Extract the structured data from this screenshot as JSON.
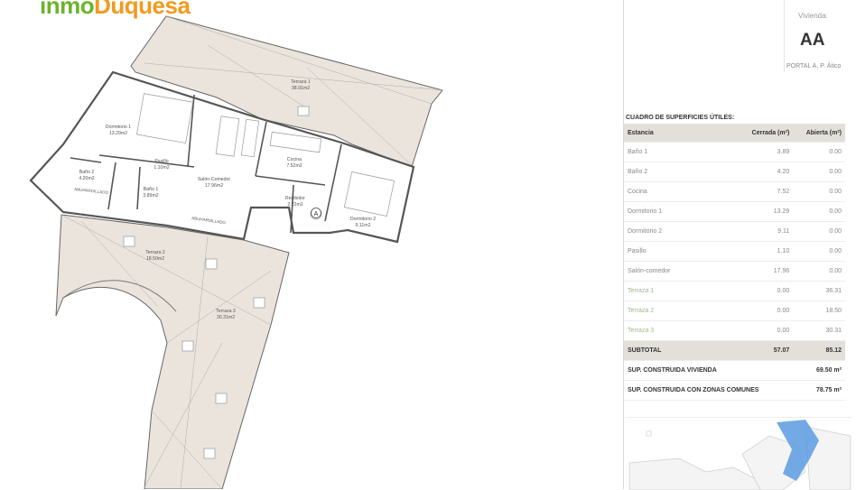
{
  "logo": {
    "part1": "inmo",
    "part2": "Duquesa"
  },
  "plan": {
    "rooms": [
      {
        "id": "terraza1",
        "name": "Terraza 1",
        "area": "38.91m2"
      },
      {
        "id": "dormitorio1",
        "name": "Dormitorio 1",
        "area": "13.29m2"
      },
      {
        "id": "pasillo",
        "name": "Pasillo",
        "area": "1.10m2"
      },
      {
        "id": "bano2",
        "name": "Baño 2",
        "area": "4.20m2"
      },
      {
        "id": "bano1",
        "name": "Baño 1",
        "area": "3.89m2"
      },
      {
        "id": "salon",
        "name": "Salón-Comedor",
        "area": "17.96m2"
      },
      {
        "id": "cocina",
        "name": "Cocina",
        "area": "7.52m2"
      },
      {
        "id": "recibidor",
        "name": "Recibidor",
        "area": "2.22m2"
      },
      {
        "id": "dormitorio2",
        "name": "Dormitorio 2",
        "area": "9.11m2"
      },
      {
        "id": "terraza2",
        "name": "Terraza 2",
        "area": "18.50m2"
      },
      {
        "id": "terraza3",
        "name": "Terraza 3",
        "area": "30.31m2"
      }
    ],
    "labels": {
      "abuhardillado1": "ABUHARDILLADO",
      "abuhardillado2": "ABUHARDILLADO",
      "marker": "A"
    }
  },
  "panel": {
    "vivienda_label": "Vivienda:",
    "vivienda_code": "AA",
    "portal": "PORTAL A, P. Ático",
    "table_title": "CUADRO DE SUPERFICIES ÚTILES:",
    "headers": {
      "estancia": "Estancia",
      "cerrada": "Cerrada (m²)",
      "abierta": "Abierta (m²)"
    },
    "rows": [
      {
        "name": "Baño 1",
        "cerrada": "3.89",
        "abierta": "0.00"
      },
      {
        "name": "Baño 2",
        "cerrada": "4.20",
        "abierta": "0.00"
      },
      {
        "name": "Cocina",
        "cerrada": "7.52",
        "abierta": "0.00"
      },
      {
        "name": "Dormitorio 1",
        "cerrada": "13.29",
        "abierta": "0.00"
      },
      {
        "name": "Dormitorio 2",
        "cerrada": "9.11",
        "abierta": "0.00"
      },
      {
        "name": "Pasillo",
        "cerrada": "1.10",
        "abierta": "0.00"
      },
      {
        "name": "Salón-comedor",
        "cerrada": "17.96",
        "abierta": "0.00"
      },
      {
        "name": "Terraza 1",
        "cerrada": "0.00",
        "abierta": "36.31"
      },
      {
        "name": "Terraza 2",
        "cerrada": "0.00",
        "abierta": "18.50"
      },
      {
        "name": "Terraza 3",
        "cerrada": "0.00",
        "abierta": "30.31"
      }
    ],
    "subtotal": {
      "label": "SUBTOTAL",
      "cerrada": "57.07",
      "abierta": "85.12"
    },
    "construida_vivienda": {
      "label": "SUP. CONSTRUIDA VIVIENDA",
      "value": "69.50 m²"
    },
    "construida_comunes": {
      "label": "SUP. CONSTRUIDA CON ZONAS COMUNES",
      "value": "78.75 m²"
    }
  },
  "colors": {
    "terrace": "#ebe4dd",
    "wall": "#666666",
    "green": "#6cb42c",
    "orange": "#f29a1f",
    "highlight": "#5b9be0"
  }
}
